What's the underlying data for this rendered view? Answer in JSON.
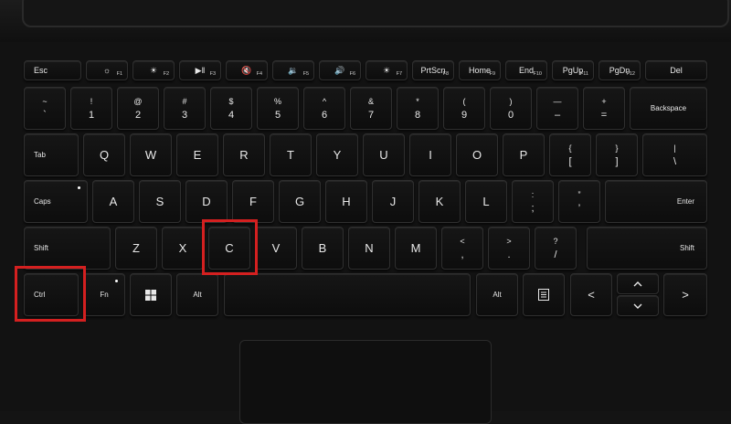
{
  "keyboard": {
    "fn_row": [
      {
        "main": "Esc",
        "sub": ""
      },
      {
        "main": "☼",
        "sub": "F1"
      },
      {
        "main": "☀",
        "sub": "F2"
      },
      {
        "main": "▶‖",
        "sub": "F3"
      },
      {
        "main": "🔇",
        "sub": "F4"
      },
      {
        "main": "🔉",
        "sub": "F5"
      },
      {
        "main": "🔊",
        "sub": "F6"
      },
      {
        "main": "☀",
        "sub": "F7"
      },
      {
        "main": "PrtScn",
        "sub": "F8"
      },
      {
        "main": "Home",
        "sub": "F9"
      },
      {
        "main": "End",
        "sub": "F10"
      },
      {
        "main": "PgUp",
        "sub": "F11"
      },
      {
        "main": "PgDn",
        "sub": "F12"
      },
      {
        "main": "Del",
        "sub": ""
      }
    ],
    "number_row": [
      {
        "top": "~",
        "bot": "`"
      },
      {
        "top": "!",
        "bot": "1"
      },
      {
        "top": "@",
        "bot": "2"
      },
      {
        "top": "#",
        "bot": "3"
      },
      {
        "top": "$",
        "bot": "4"
      },
      {
        "top": "%",
        "bot": "5"
      },
      {
        "top": "^",
        "bot": "6"
      },
      {
        "top": "&",
        "bot": "7"
      },
      {
        "top": "*",
        "bot": "8"
      },
      {
        "top": "(",
        "bot": "9"
      },
      {
        "top": ")",
        "bot": "0"
      },
      {
        "top": "—",
        "bot": "–"
      },
      {
        "top": "+",
        "bot": "="
      }
    ],
    "backspace": "Backspace",
    "tab": "Tab",
    "qwerty": [
      "Q",
      "W",
      "E",
      "R",
      "T",
      "Y",
      "U",
      "I",
      "O",
      "P"
    ],
    "brackets": [
      {
        "top": "{",
        "bot": "["
      },
      {
        "top": "}",
        "bot": "]"
      },
      {
        "top": "|",
        "bot": "\\"
      }
    ],
    "caps": "Caps",
    "home_row": [
      "A",
      "S",
      "D",
      "F",
      "G",
      "H",
      "J",
      "K",
      "L"
    ],
    "semicolon": {
      "top": ":",
      "bot": ";"
    },
    "quote": {
      "top": "”",
      "bot": "’"
    },
    "enter": "Enter",
    "shift_left": "Shift",
    "bottom_letters": [
      "Z",
      "X",
      "C",
      "V",
      "B",
      "N",
      "M"
    ],
    "comma": {
      "top": "<",
      "bot": ","
    },
    "period": {
      "top": ">",
      "bot": "."
    },
    "slash": {
      "top": "?",
      "bot": "/"
    },
    "shift_right": "Shift",
    "ctrl": "Ctrl",
    "fn": "Fn",
    "alt_left": "Alt",
    "alt_right": "Alt",
    "arrow_left": "<",
    "arrow_up": "^",
    "arrow_down": "v",
    "arrow_right": ">"
  },
  "highlight_color": "#d42020"
}
